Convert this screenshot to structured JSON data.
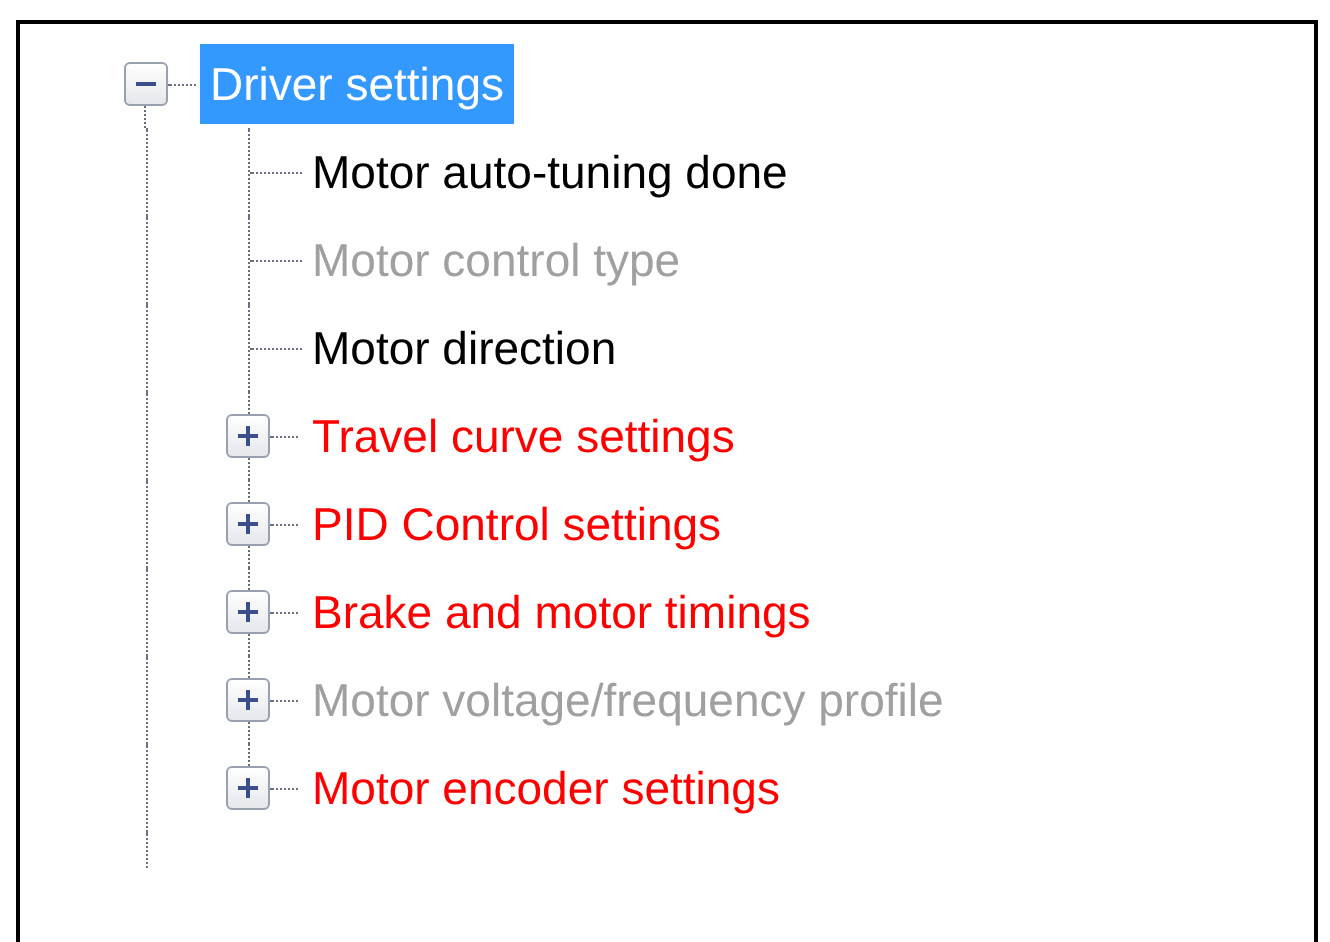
{
  "tree": {
    "label": "Driver settings",
    "selected": true,
    "expanded": true,
    "children": [
      {
        "kind": "leaf",
        "label": "Motor auto-tuning done",
        "selected": false,
        "color": "#000000"
      },
      {
        "kind": "leaf",
        "label": "Motor control type",
        "selected": false,
        "color": "#a0a0a0"
      },
      {
        "kind": "leaf",
        "label": "Motor direction",
        "selected": false,
        "color": "#000000"
      },
      {
        "kind": "group",
        "label": "Travel curve settings",
        "selected": false,
        "expanded": false,
        "color": "#ff0000"
      },
      {
        "kind": "group",
        "label": "PID Control settings",
        "selected": false,
        "expanded": false,
        "color": "#ff0000"
      },
      {
        "kind": "group",
        "label": "Brake and motor timings",
        "selected": false,
        "expanded": false,
        "color": "#ff0000"
      },
      {
        "kind": "group",
        "label": "Motor voltage/frequency profile",
        "selected": false,
        "expanded": false,
        "color": "#a0a0a0"
      },
      {
        "kind": "group",
        "label": "Motor encoder settings",
        "selected": false,
        "expanded": false,
        "color": "#ff0000"
      }
    ]
  }
}
